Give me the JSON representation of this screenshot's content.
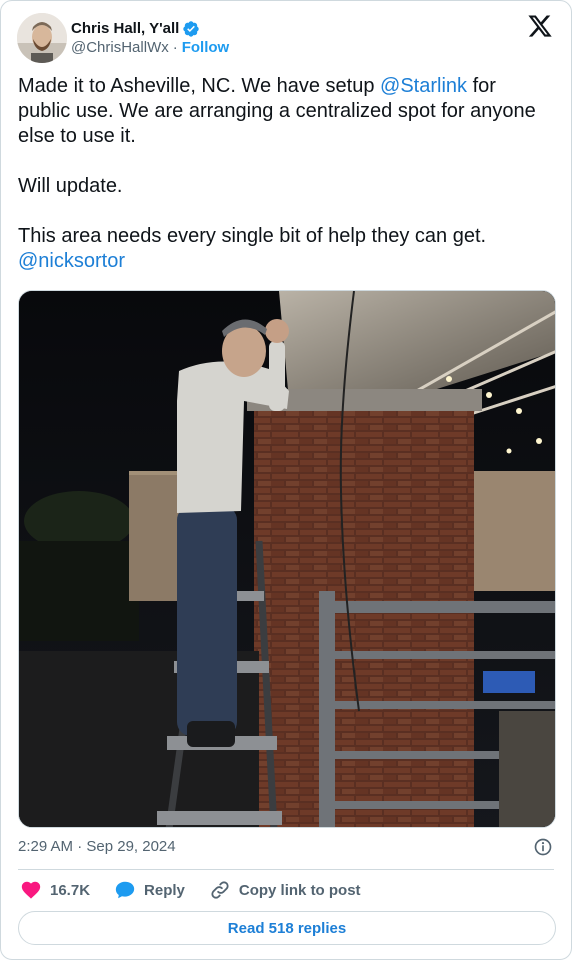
{
  "author": {
    "name": "Chris Hall, Y'all",
    "handle": "@ChrisHallWx",
    "separator": "·",
    "follow_label": "Follow",
    "verified": true
  },
  "tweet": {
    "text_line1": "Made it to Asheville, NC. We have setup ",
    "mention_starlink": "@Starlink",
    "text_line1b": " for public use. We are arranging a centralized spot for anyone else to use it.",
    "text_para2": "Will update.",
    "text_para3": "This area needs every single bit of help they can get. ",
    "mention_nicksortor": "@nicksortor"
  },
  "meta": {
    "timestamp": "2:29 AM · Sep 29, 2024"
  },
  "actions": {
    "like_count": "16.7K",
    "reply_label": "Reply",
    "copy_label": "Copy link to post"
  },
  "footer": {
    "read_replies_label": "Read 518 replies"
  },
  "colors": {
    "accent": "#1d9bf0",
    "link": "#1d7fd6",
    "like": "#f91880",
    "muted": "#536471",
    "border": "#cfd9de"
  },
  "icons": {
    "brand": "x-logo-icon",
    "verified": "verified-badge-icon",
    "info": "info-icon",
    "like": "heart-icon",
    "reply": "reply-bubble-icon",
    "copy": "link-icon"
  }
}
